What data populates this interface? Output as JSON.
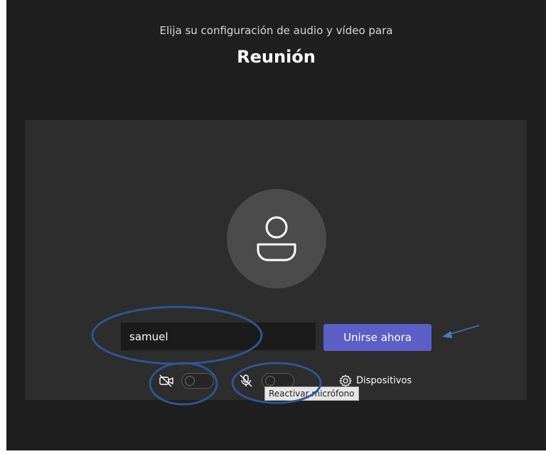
{
  "header": {
    "subtitle": "Elija su configuración de audio y vídeo para",
    "title": "Reunión"
  },
  "prejoin": {
    "name_value": "samuel",
    "join_label": "Unirse ahora",
    "camera_toggle": "off",
    "mic_toggle": "off",
    "devices_label": "Dispositivos",
    "mic_tooltip": "Reactivar micrófono"
  },
  "icons": {
    "avatar": "person-icon",
    "camera": "camera-off-icon",
    "mic": "mic-off-icon",
    "devices": "gear-icon"
  },
  "colors": {
    "background": "#1f1f1f",
    "stage": "#2d2d2d",
    "primary_button": "#5b5fc7",
    "annotation": "#2f5597"
  }
}
